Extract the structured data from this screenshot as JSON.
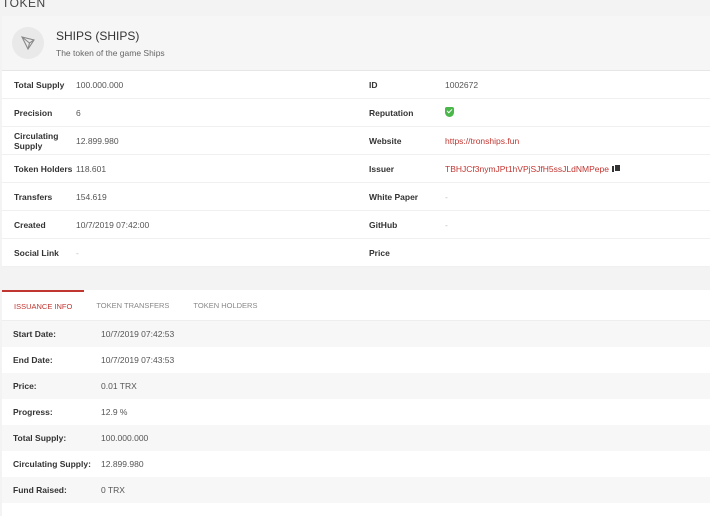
{
  "page": {
    "heading": "TOKEN"
  },
  "token": {
    "name": "SHIPS (SHIPS)",
    "description": "The token of the game Ships",
    "logo_icon": "tron-icon"
  },
  "info_left": [
    {
      "label": "Total Supply",
      "value": "100.000.000"
    },
    {
      "label": "Precision",
      "value": "6"
    },
    {
      "label": "Circulating Supply",
      "value": "12.899.980"
    },
    {
      "label": "Token Holders",
      "value": "118.601"
    },
    {
      "label": "Transfers",
      "value": "154.619"
    },
    {
      "label": "Created",
      "value": "10/7/2019 07:42:00"
    },
    {
      "label": "Social Link",
      "value": "-"
    }
  ],
  "info_right": {
    "id": {
      "label": "ID",
      "value": "1002672"
    },
    "reputation": {
      "label": "Reputation",
      "icon": "verified-shield-icon",
      "color": "#4bb74b"
    },
    "website": {
      "label": "Website",
      "value": "https://tronships.fun"
    },
    "issuer": {
      "label": "Issuer",
      "value": "TBHJCf3nymJPt1hVPjSJfH5ssJLdNMPepe",
      "icon": "copy-icon"
    },
    "white_paper": {
      "label": "White Paper",
      "value": "-"
    },
    "github": {
      "label": "GitHub",
      "value": "-"
    },
    "price": {
      "label": "Price",
      "value": ""
    }
  },
  "tabs": [
    {
      "label": "ISSUANCE INFO",
      "active": true
    },
    {
      "label": "TOKEN TRANSFERS",
      "active": false
    },
    {
      "label": "TOKEN HOLDERS",
      "active": false
    }
  ],
  "issuance": {
    "start_date": {
      "label": "Start Date:",
      "value": "10/7/2019 07:42:53"
    },
    "end_date": {
      "label": "End Date:",
      "value": "10/7/2019 07:43:53"
    },
    "price": {
      "label": "Price:",
      "value": "0.01 TRX"
    },
    "progress": {
      "label": "Progress:",
      "value": "12.9 %"
    },
    "total_supply": {
      "label": "Total Supply:",
      "value": "100.000.000"
    },
    "circulating_supply": {
      "label": "Circulating Supply:",
      "value": "12.899.980"
    },
    "fund_raised": {
      "label": "Fund Raised:",
      "value": "0 TRX"
    }
  },
  "colors": {
    "accent": "#c23631",
    "verified": "#4bb74b"
  }
}
